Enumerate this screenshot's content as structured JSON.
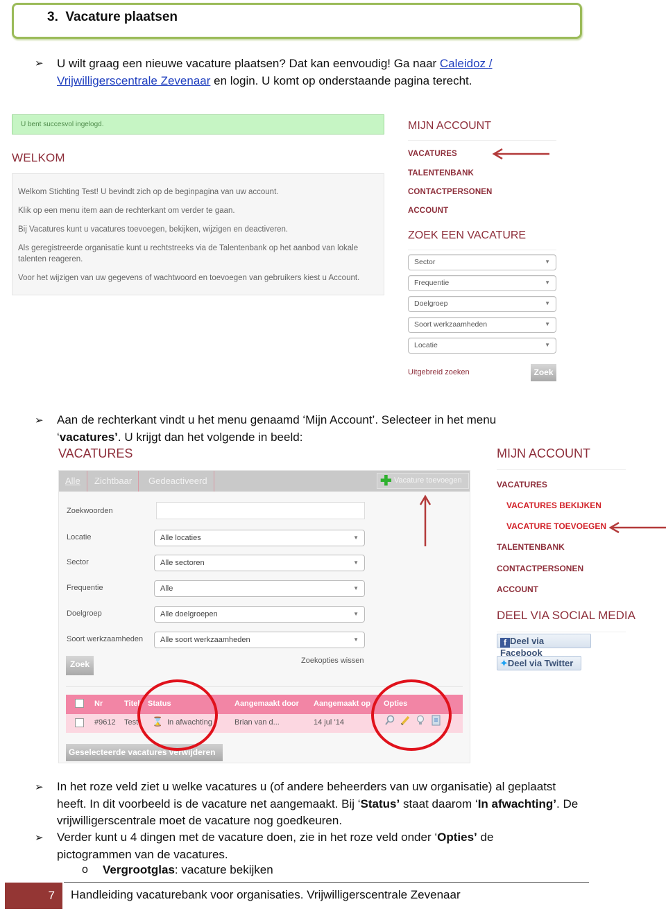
{
  "heading": {
    "number": "3.",
    "title": "Vacature plaatsen"
  },
  "intro": {
    "text_before": "U wilt graag een nieuwe vacature plaatsen? Dat kan eenvoudig! Ga naar ",
    "link_line1": "Caleidoz /",
    "link_line2": "Vrijwilligerscentrale Zevenaar",
    "text_after": " en login. U komt op onderstaande pagina terecht."
  },
  "screenshot1": {
    "success_message": "U bent succesvol ingelogd.",
    "welcome_title": "WELKOM",
    "welcome_paragraphs": [
      "Welkom Stichting Test! U bevindt zich op de beginpagina van uw account.",
      "Klik op een menu item aan de rechterkant om verder te gaan.",
      "Bij Vacatures kunt u vacatures toevoegen, bekijken, wijzigen en deactiveren.",
      "Als geregistreerde organisatie kunt u rechtstreeks via de Talentenbank op het aanbod van lokale talenten reageren.",
      "Voor het wijzigen van uw gegevens of wachtwoord en toevoegen van gebruikers kiest u Account."
    ],
    "sidebar": {
      "account_heading": "MIJN ACCOUNT",
      "items": [
        "VACATURES",
        "TALENTENBANK",
        "CONTACTPERSONEN",
        "ACCOUNT"
      ],
      "search_heading": "ZOEK EEN VACATURE",
      "selects": [
        "Sector",
        "Frequentie",
        "Doelgroep",
        "Soort werkzaamheden",
        "Locatie"
      ],
      "advanced_link": "Uitgebreid zoeken",
      "search_button": "Zoek"
    }
  },
  "bullet2": {
    "line1": "Aan de rechterkant vindt u het menu genaamd ‘Mijn Account’. Selecteer in het menu",
    "quote_open": "‘",
    "bold": "vacatures’",
    "rest": ". U krijgt dan het volgende in beeld:"
  },
  "screenshot2": {
    "title": "VACATURES",
    "tabs": [
      "Alle",
      "Zichtbaar",
      "Gedeactiveerd"
    ],
    "add_button": "Vacature toevoegen",
    "filters": [
      {
        "label": "Zoekwoorden",
        "value": ""
      },
      {
        "label": "Locatie",
        "value": "Alle locaties"
      },
      {
        "label": "Sector",
        "value": "Alle sectoren"
      },
      {
        "label": "Frequentie",
        "value": "Alle"
      },
      {
        "label": "Doelgroep",
        "value": "Alle doelgroepen"
      },
      {
        "label": "Soort werkzaamheden",
        "value": "Alle soort werkzaamheden"
      }
    ],
    "search_button": "Zoek",
    "clear_link": "Zoekopties wissen",
    "table": {
      "headers": [
        "Nr",
        "Titel",
        "Status",
        "Aangemaakt door",
        "Aangemaakt op",
        "Opties"
      ],
      "rows": [
        {
          "nr": "#9612",
          "titel": "Test",
          "status": "In afwachting",
          "door": "Brian van d...",
          "op": "14 jul ’14"
        }
      ],
      "option_icons": [
        "magnifier-icon",
        "pencil-icon",
        "lightbulb-icon",
        "document-icon"
      ]
    },
    "delete_button": "Geselecteerde vacatures verwijderen",
    "sidebar": {
      "account_heading": "MIJN ACCOUNT",
      "items": [
        "VACATURES"
      ],
      "subitems": [
        "VACATURES BEKIJKEN",
        "VACATURE TOEVOEGEN"
      ],
      "items_after": [
        "TALENTENBANK",
        "CONTACTPERSONEN",
        "ACCOUNT"
      ],
      "social_heading": "DEEL VIA SOCIAL MEDIA",
      "facebook": "Deel via Facebook",
      "twitter": "Deel via Twitter"
    }
  },
  "bullet3": {
    "p1": "In het roze veld ziet u welke vacatures u (of andere beheerders van uw organisatie) al geplaatst heeft. In dit voorbeeld is de vacature net aangemaakt. Bij ‘",
    "b1": "Status’",
    "p2": " staat daarom ‘",
    "b2": "In afwachting’",
    "p3": ". De vrijwilligerscentrale moet de  vacature nog goedkeuren."
  },
  "bullet4": {
    "p1": "Verder kunt u 4 dingen met de vacature doen, zie in het roze veld onder ‘",
    "b1": "Opties’",
    "p2": " de pictogrammen van de vacatures."
  },
  "sub_bullet": {
    "bold": "Vergrootglas",
    "text": ": vacature bekijken"
  },
  "footer": {
    "page": "7",
    "text": "Handleiding vacaturebank voor organisaties. Vrijwilligerscentrale  Zevenaar"
  },
  "colors": {
    "heading_border": "#9bbb59",
    "maroon": "#8e2f3b",
    "pink_header": "#f285a5",
    "pink_row": "#fcd7e1",
    "annotation_red": "#e0121c",
    "footer_block": "#943634"
  }
}
